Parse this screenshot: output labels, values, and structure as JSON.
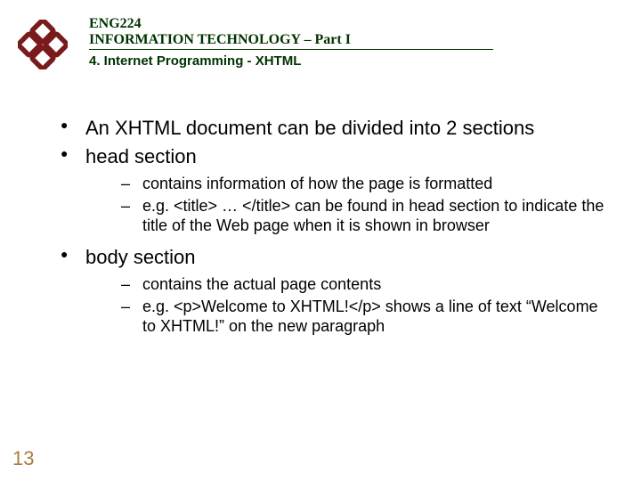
{
  "header": {
    "course_code": "ENG224",
    "course_title": "INFORMATION TECHNOLOGY – Part I",
    "section_label": "4. Internet Programming - XHTML"
  },
  "bullets": [
    {
      "text": "An XHTML document can be divided into 2 sections"
    },
    {
      "text": "head section",
      "sub": [
        "contains information of how the page is formatted",
        "e.g. <title> … </title> can be found in head section to indicate the title of the Web page when it is shown in browser"
      ]
    },
    {
      "text": "body section",
      "sub": [
        "contains the actual page contents",
        "e.g. <p>Welcome to XHTML!</p> shows a line of text “Welcome to XHTML!” on the new paragraph"
      ]
    }
  ],
  "page_number": "13",
  "logo": {
    "color": "#7a1b1b"
  }
}
